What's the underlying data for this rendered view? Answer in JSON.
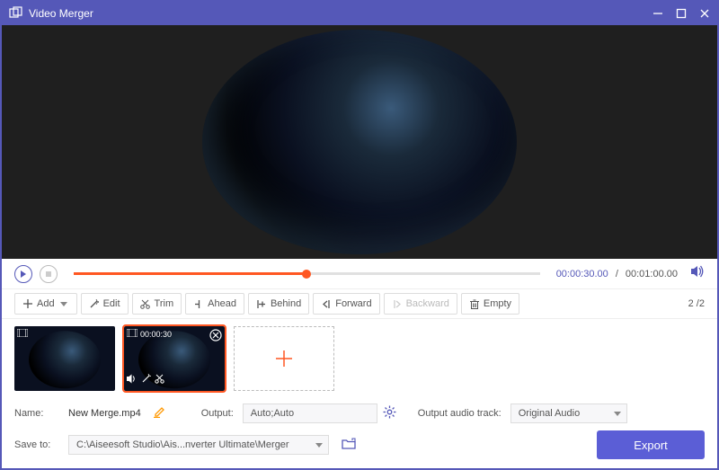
{
  "titlebar": {
    "title": "Video Merger"
  },
  "player": {
    "current_time": "00:00:30.00",
    "total_time": "00:01:00.00",
    "progress_pct": 50
  },
  "toolbar": {
    "add": "Add",
    "edit": "Edit",
    "trim": "Trim",
    "ahead": "Ahead",
    "behind": "Behind",
    "forward": "Forward",
    "backward": "Backward",
    "empty": "Empty",
    "counter_current": "2",
    "counter_total": "2"
  },
  "clips": [
    {
      "selected": false
    },
    {
      "selected": true,
      "duration": "00:00:30"
    }
  ],
  "output": {
    "name_label": "Name:",
    "name_value": "New Merge.mp4",
    "output_label": "Output:",
    "output_value": "Auto;Auto",
    "audio_label": "Output audio track:",
    "audio_value": "Original Audio",
    "save_label": "Save to:",
    "save_path": "C:\\Aiseesoft Studio\\Ais...nverter Ultimate\\Merger",
    "export_label": "Export"
  }
}
